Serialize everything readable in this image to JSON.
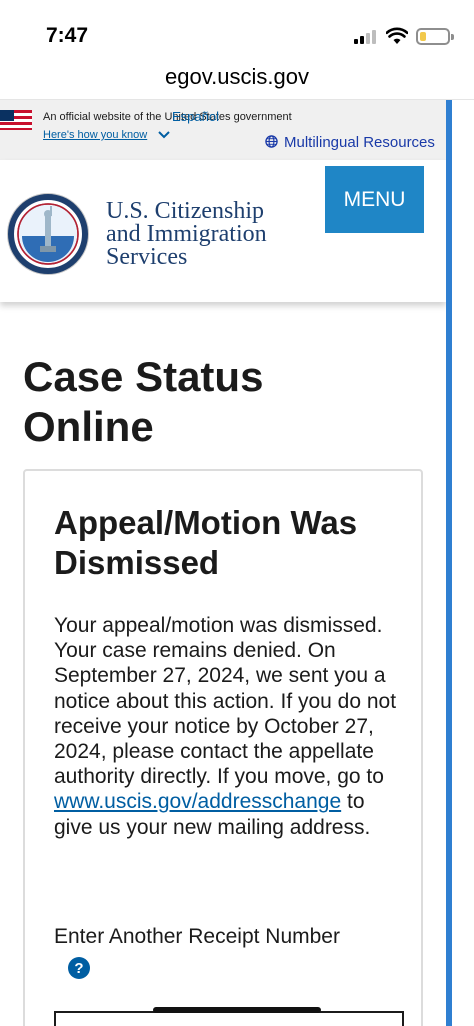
{
  "status_bar": {
    "time": "7:47"
  },
  "browser": {
    "url": "egov.uscis.gov"
  },
  "gov_banner": {
    "official_text": "An official website of the United States government",
    "espanol": "Español",
    "how_you_know": "Here's how you know",
    "multilingual": "Multilingual Resources"
  },
  "header": {
    "agency_line1": "U.S. Citizenship",
    "agency_line2": "and Immigration",
    "agency_line3": "Services",
    "menu_label": "MENU"
  },
  "main": {
    "page_title_line1": "Case Status",
    "page_title_line2": "Online",
    "status_title_line1": "Appeal/Motion Was",
    "status_title_line2": "Dismissed",
    "body_before_link": "Your appeal/motion was dismissed. Your case remains denied. On September 27, 2024, we sent you a notice about this action. If you do not receive your notice by October 27, 2024, please contact the appellate authority directly. If you move, go to ",
    "link_text": "www.uscis.gov/addresschange",
    "body_after_link": " to give us your new mailing address.",
    "receipt_label": "Enter Another Receipt Number",
    "help_glyph": "?"
  },
  "icons": {
    "flag": "us-flag-icon",
    "chevron": "chevron-down-icon",
    "globe": "globe-icon",
    "help": "question-circle-icon"
  },
  "colors": {
    "menu_button": "#1f86c6",
    "link": "#005ea2",
    "agency_text": "#1e3f6e",
    "scroll_edge": "#2f7fd1"
  }
}
